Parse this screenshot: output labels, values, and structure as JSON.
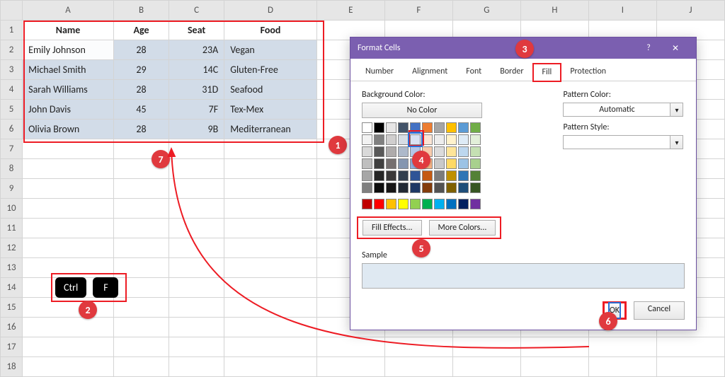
{
  "columns": [
    "A",
    "B",
    "C",
    "D",
    "E",
    "F",
    "G",
    "H",
    "I",
    "J"
  ],
  "rows": [
    "1",
    "2",
    "3",
    "4",
    "5",
    "6",
    "7",
    "8",
    "9",
    "10",
    "11",
    "12",
    "13",
    "14",
    "15",
    "16",
    "17",
    "18"
  ],
  "col_widths": {
    "A": 132,
    "B": 80,
    "C": 80,
    "D": 132,
    "E": 100,
    "F": 100,
    "G": 100,
    "H": 100,
    "I": 100,
    "J": 100
  },
  "headers": {
    "A": "Name",
    "B": "Age",
    "C": "Seat",
    "D": "Food"
  },
  "data": [
    {
      "A": "Emily Johnson",
      "B": "28",
      "C": "23A",
      "D": "Vegan"
    },
    {
      "A": "Michael Smith",
      "B": "29",
      "C": "14C",
      "D": "Gluten-Free"
    },
    {
      "A": "Sarah Williams",
      "B": "28",
      "C": "31D",
      "D": "Seafood"
    },
    {
      "A": "John Davis",
      "B": "45",
      "C": "7F",
      "D": "Tex-Mex"
    },
    {
      "A": "Olivia Brown",
      "B": "28",
      "C": "9B",
      "D": "Mediterranean"
    }
  ],
  "keys": {
    "ctrl": "Ctrl",
    "f": "F"
  },
  "dialog": {
    "title": "Format Cells",
    "tabs": [
      "Number",
      "Alignment",
      "Font",
      "Border",
      "Fill",
      "Protection"
    ],
    "active_tab": "Fill",
    "bg_label": "Background Color:",
    "nocolor": "No Color",
    "fill_effects": "Fill Effects...",
    "more_colors": "More Colors...",
    "pattern_color_label": "Pattern Color:",
    "pattern_color_value": "Automatic",
    "pattern_style_label": "Pattern Style:",
    "sample_label": "Sample",
    "ok": "OK",
    "cancel": "Cancel"
  },
  "theme_colors_rows": [
    [
      "#ffffff",
      "#000000",
      "#e7e6e6",
      "#44546a",
      "#4472c4",
      "#ed7d31",
      "#a5a5a5",
      "#ffc000",
      "#5b9bd5",
      "#70ad47"
    ],
    [
      "#f2f2f2",
      "#808080",
      "#d0cece",
      "#d6dce4",
      "#d9e2f3",
      "#fbe5d5",
      "#ededed",
      "#fff2cc",
      "#deebf6",
      "#e2efd9"
    ],
    [
      "#d9d9d9",
      "#595959",
      "#aeabab",
      "#adb9ca",
      "#b4c6e7",
      "#f7cbac",
      "#dbdbdb",
      "#fee599",
      "#bdd7ee",
      "#c5e0b3"
    ],
    [
      "#bfbfbf",
      "#404040",
      "#757070",
      "#8496b0",
      "#8eaadb",
      "#f4b183",
      "#c9c9c9",
      "#ffd965",
      "#9cc3e5",
      "#a8d08d"
    ],
    [
      "#a6a6a6",
      "#262626",
      "#3a3838",
      "#323f4f",
      "#2f5496",
      "#c55a11",
      "#7b7b7b",
      "#bf9000",
      "#2e75b5",
      "#538135"
    ],
    [
      "#7f7f7f",
      "#0d0d0d",
      "#171616",
      "#222a35",
      "#1f3864",
      "#833c0b",
      "#525252",
      "#7f6000",
      "#1e4e79",
      "#375623"
    ]
  ],
  "standard_colors": [
    "#c00000",
    "#ff0000",
    "#ffc000",
    "#ffff00",
    "#92d050",
    "#00b050",
    "#00b0f0",
    "#0070c0",
    "#002060",
    "#7030a0"
  ],
  "selected_swatch": {
    "row": 1,
    "col": 4
  },
  "annotations": {
    "1": "1",
    "2": "2",
    "3": "3",
    "4": "4",
    "5": "5",
    "6": "6",
    "7": "7"
  }
}
